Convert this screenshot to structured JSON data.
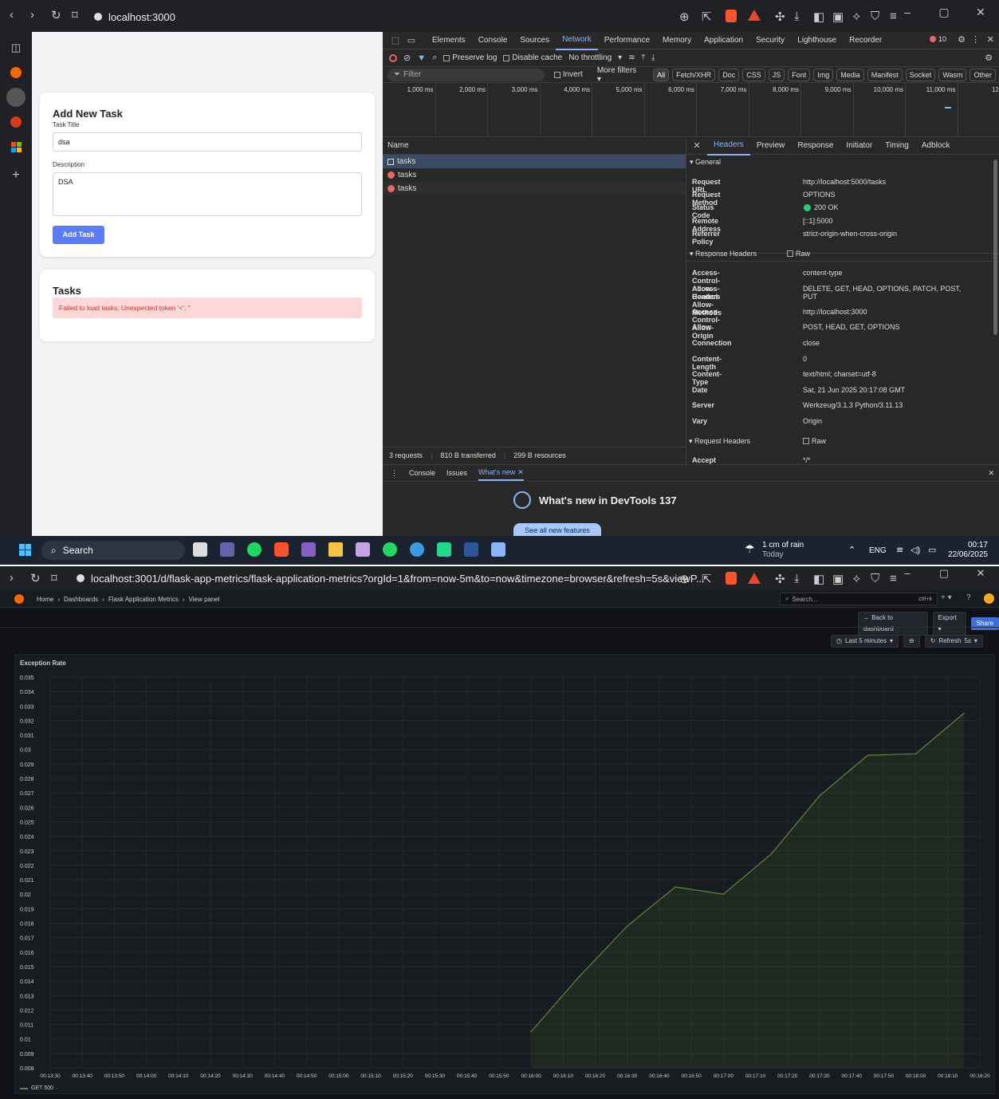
{
  "top_browser": {
    "url": "localhost:3000",
    "app": {
      "add_card": {
        "title": "Add New Task",
        "task_title_label": "Task Title",
        "task_title_value": "dsa",
        "description_label": "Description",
        "description_value": "DSA",
        "add_button": "Add Task"
      },
      "tasks_card": {
        "title": "Tasks",
        "error": "Failed to load tasks: Unexpected token '<', \""
      }
    },
    "devtools": {
      "tabs": [
        "Elements",
        "Console",
        "Sources",
        "Network",
        "Performance",
        "Memory",
        "Application",
        "Security",
        "Lighthouse",
        "Recorder"
      ],
      "active_tab": "Network",
      "error_count": "10",
      "toolbar": {
        "preserve_log": "Preserve log",
        "disable_cache": "Disable cache",
        "throttling": "No throttling"
      },
      "filter": {
        "placeholder": "Filter",
        "invert": "Invert",
        "more_filters": "More filters ▾",
        "chips": [
          "All",
          "Fetch/XHR",
          "Doc",
          "CSS",
          "JS",
          "Font",
          "Img",
          "Media",
          "Manifest",
          "Socket",
          "Wasm",
          "Other"
        ]
      },
      "timeline_ticks": [
        "1,000 ms",
        "2,000 ms",
        "3,000 ms",
        "4,000 ms",
        "5,000 ms",
        "6,000 ms",
        "7,000 ms",
        "8,000 ms",
        "9,000 ms",
        "10,000 ms",
        "11,000 ms",
        "12,00"
      ],
      "name_header": "Name",
      "requests": [
        "tasks",
        "tasks",
        "tasks"
      ],
      "detail_tabs": [
        "Headers",
        "Preview",
        "Response",
        "Initiator",
        "Timing",
        "Adblock"
      ],
      "general_title": "▾ General",
      "general": [
        {
          "k": "Request URL",
          "v": "http://localhost:5000/tasks"
        },
        {
          "k": "Request Method",
          "v": "OPTIONS"
        },
        {
          "k": "Status Code",
          "v": "200 OK"
        },
        {
          "k": "Remote Address",
          "v": "[::1]:5000"
        },
        {
          "k": "Referrer Policy",
          "v": "strict-origin-when-cross-origin"
        }
      ],
      "response_headers_title": "▾ Response Headers",
      "raw": "Raw",
      "response_headers": [
        {
          "k": "Access-Control-Allow-Headers",
          "v": "content-type"
        },
        {
          "k": "Access-Control-Allow-Methods",
          "v": "DELETE, GET, HEAD, OPTIONS, PATCH, POST, PUT"
        },
        {
          "k": "Access-Control-Allow-Origin",
          "v": "http://localhost:3000"
        },
        {
          "k": "Allow",
          "v": "POST, HEAD, GET, OPTIONS"
        },
        {
          "k": "Connection",
          "v": "close"
        },
        {
          "k": "Content-Length",
          "v": "0"
        },
        {
          "k": "Content-Type",
          "v": "text/html; charset=utf-8"
        },
        {
          "k": "Date",
          "v": "Sat, 21 Jun 2025 20:17:08 GMT"
        },
        {
          "k": "Server",
          "v": "Werkzeug/3.1.3 Python/3.11.13"
        },
        {
          "k": "Vary",
          "v": "Origin"
        }
      ],
      "request_headers_title": "▾ Request Headers",
      "accept": {
        "k": "Accept",
        "v": "*/*"
      },
      "status_bar": {
        "requests": "3 requests",
        "transferred": "810 B transferred",
        "resources": "299 B resources"
      },
      "drawer_tabs": [
        "Console",
        "Issues",
        "What's new"
      ],
      "whats_new": "What's new in DevTools 137",
      "see_all": "See all new features"
    },
    "taskbar": {
      "search": "Search",
      "weather": "1 cm of rain",
      "weather_sub": "Today",
      "lang": "ENG",
      "time": "00:17",
      "date": "22/06/2025"
    }
  },
  "bottom_browser": {
    "url": "localhost:3001/d/flask-app-metrics/flask-application-metrics?orgId=1&from=now-5m&to=now&timezone=browser&refresh=5s&viewP...",
    "breadcrumb": [
      "Home",
      "Dashboards",
      "Flask Application Metrics",
      "View panel"
    ],
    "search_placeholder": "Search...",
    "search_shortcut": "ctrl+k",
    "buttons": {
      "back": "← Back to dashboard",
      "export": "Export ▾",
      "share": "Share"
    },
    "time_range": "Last 5 minutes",
    "refresh": "Refresh",
    "refresh_interval": "5s",
    "panel_title": "Exception Rate",
    "legend": "GET 500"
  },
  "colors": {
    "series": "#5a8a3a",
    "accent": "#8ab4f8",
    "grafana_bg": "#111217",
    "error_bg": "#fdd8d8"
  },
  "chart_data": {
    "type": "area",
    "title": "Exception Rate",
    "ylim": [
      0.008,
      0.035
    ],
    "yticks": [
      "0.035",
      "0.034",
      "0.033",
      "0.032",
      "0.031",
      "0.03",
      "0.029",
      "0.028",
      "0.027",
      "0.026",
      "0.025",
      "0.024",
      "0.023",
      "0.022",
      "0.021",
      "0.02",
      "0.019",
      "0.018",
      "0.017",
      "0.016",
      "0.015",
      "0.014",
      "0.013",
      "0.012",
      "0.011",
      "0.01",
      "0.009",
      "0.008"
    ],
    "xticks": [
      "00:13:30",
      "00:13:40",
      "00:13:50",
      "00:14:00",
      "00:14:10",
      "00:14:20",
      "00:14:30",
      "00:14:40",
      "00:14:50",
      "00:15:00",
      "00:15:10",
      "00:15:20",
      "00:15:30",
      "00:15:40",
      "00:15:50",
      "00:16:00",
      "00:16:10",
      "00:16:20",
      "00:16:30",
      "00:16:40",
      "00:16:50",
      "00:17:00",
      "00:17:10",
      "00:17:20",
      "00:17:30",
      "00:17:40",
      "00:17:50",
      "00:18:00",
      "00:18:10",
      "00:18:20"
    ],
    "series": [
      {
        "name": "GET 500",
        "x": [
          "00:16:00",
          "00:16:15",
          "00:16:30",
          "00:16:45",
          "00:17:00",
          "00:17:15",
          "00:17:30",
          "00:17:45",
          "00:18:00",
          "00:18:15"
        ],
        "values": [
          0.0105,
          0.0143,
          0.0178,
          0.0205,
          0.02,
          0.0228,
          0.0268,
          0.0296,
          0.0297,
          0.0325
        ]
      }
    ]
  }
}
